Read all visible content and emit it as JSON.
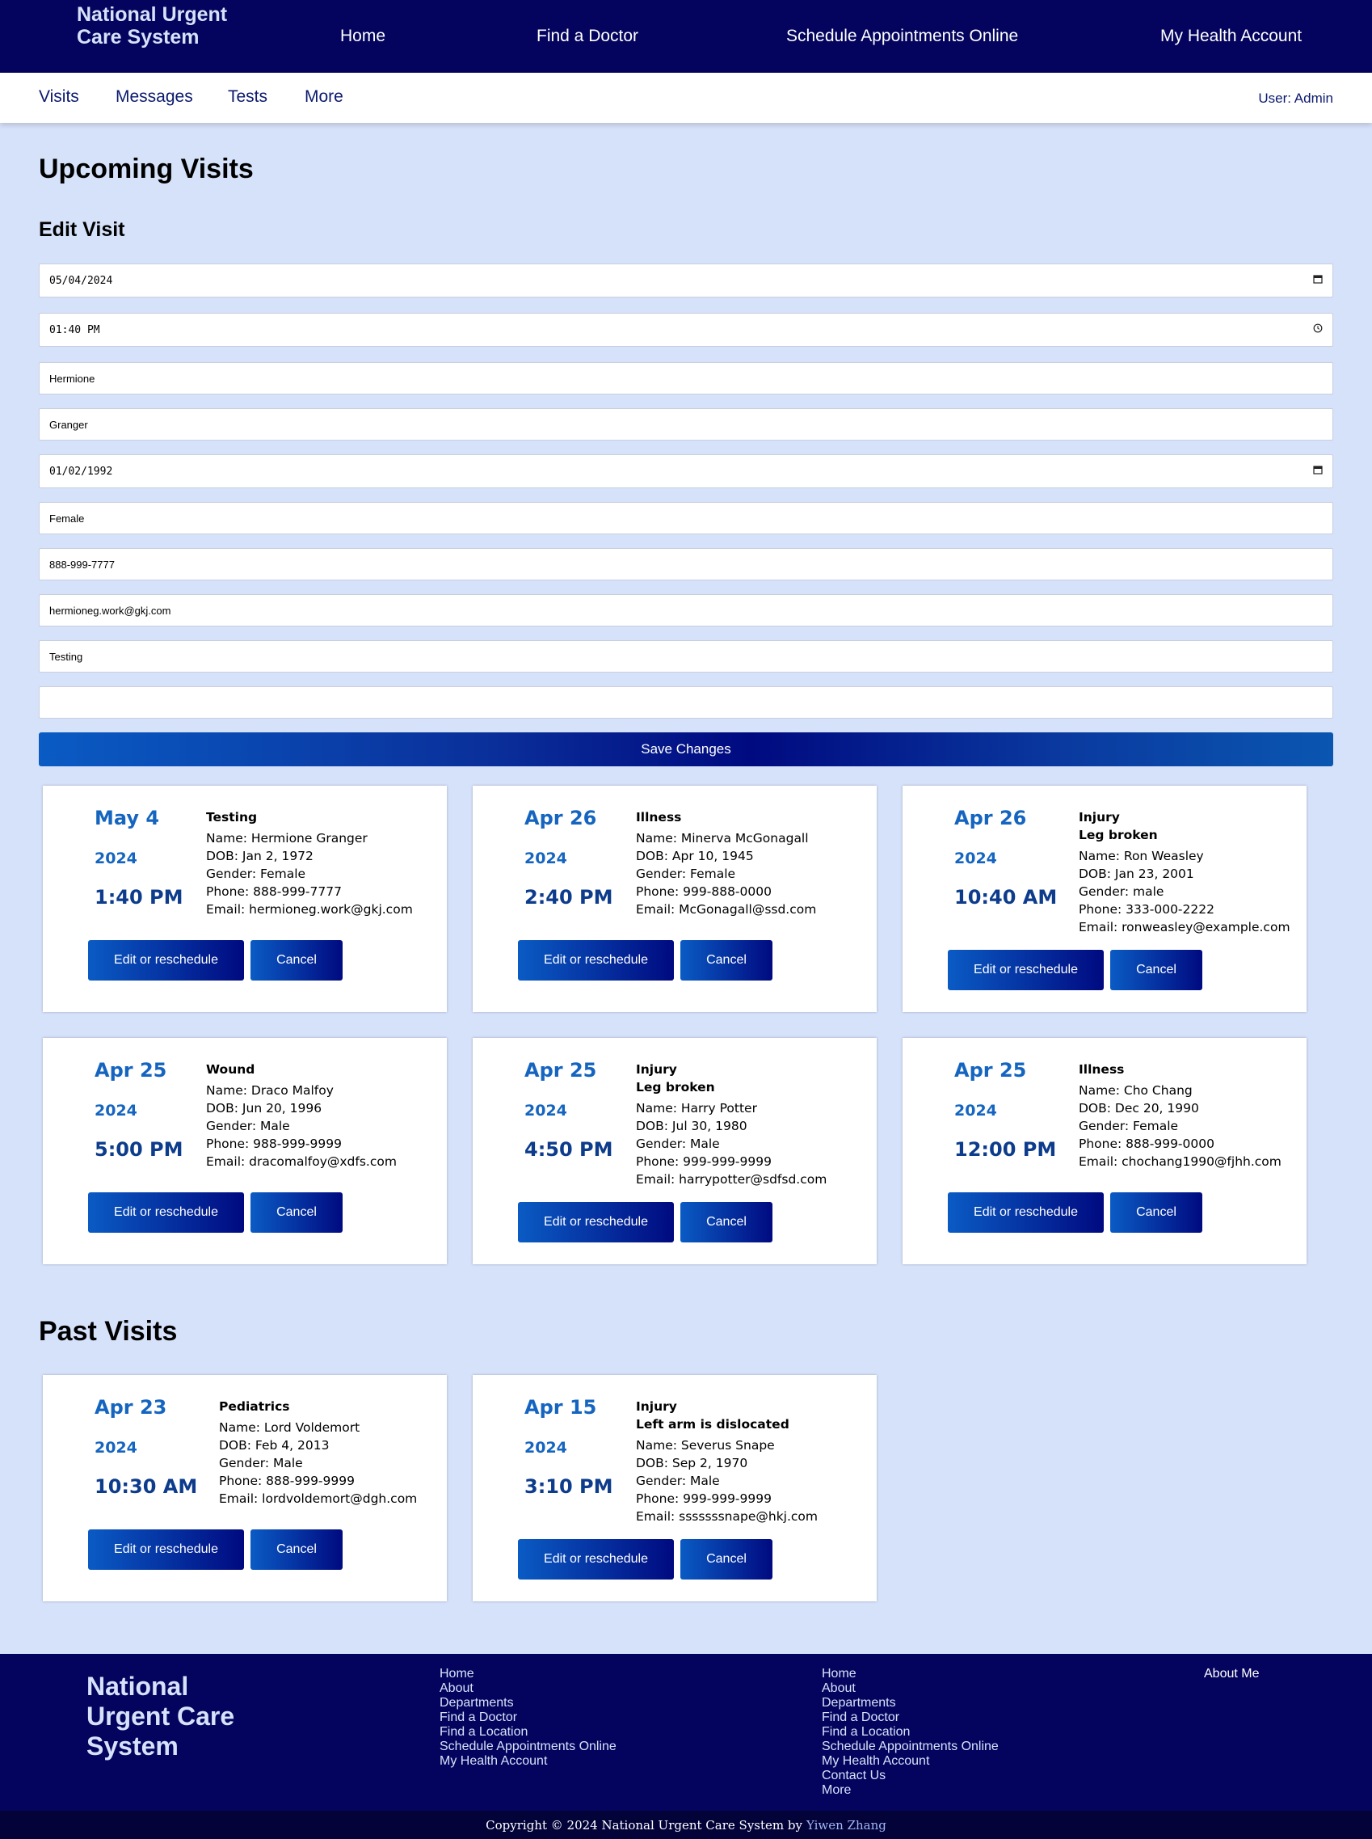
{
  "header": {
    "brand": "National Urgent Care System",
    "nav": [
      "Home",
      "Find a Doctor",
      "Schedule Appointments Online",
      "My Health Account"
    ]
  },
  "subnav": {
    "items": [
      "Visits",
      "Messages",
      "Tests",
      "More"
    ],
    "user": "User: Admin"
  },
  "upcoming_title": "Upcoming Visits",
  "edit_form": {
    "title": "Edit Visit",
    "date": "05/04/2024",
    "time": "01:40 PM",
    "first_name": "Hermione",
    "last_name": "Granger",
    "dob": "01/02/1992",
    "gender": "Female",
    "phone": "888-999-7777",
    "email": "hermioneg.work@gkj.com",
    "reason": "Testing",
    "notes": "",
    "save_label": "Save Changes",
    "calendar_icon": "calendar-icon",
    "clock_icon": "clock-icon"
  },
  "buttons": {
    "edit": "Edit or reschedule",
    "cancel": "Cancel"
  },
  "upcoming_visits": [
    {
      "date": "May 4",
      "year": "2024",
      "time": "1:40 PM",
      "type": "Testing",
      "detail": "",
      "name": "Name: Hermione Granger",
      "dob": "DOB: Jan 2, 1972",
      "gender": "Gender: Female",
      "phone": "Phone: 888-999-7777",
      "email": "Email: hermioneg.work@gkj.com"
    },
    {
      "date": "Apr 26",
      "year": "2024",
      "time": "2:40 PM",
      "type": "Illness",
      "detail": "",
      "name": "Name: Minerva McGonagall",
      "dob": "DOB: Apr 10, 1945",
      "gender": "Gender: Female",
      "phone": "Phone: 999-888-0000",
      "email": "Email: McGonagall@ssd.com"
    },
    {
      "date": "Apr 26",
      "year": "2024",
      "time": "10:40 AM",
      "type": "Injury",
      "detail": "Leg broken",
      "name": "Name: Ron Weasley",
      "dob": "DOB: Jan 23, 2001",
      "gender": "Gender: male",
      "phone": "Phone: 333-000-2222",
      "email": "Email: ronweasley@example.com"
    },
    {
      "date": "Apr 25",
      "year": "2024",
      "time": "5:00 PM",
      "type": "Wound",
      "detail": "",
      "name": "Name: Draco Malfoy",
      "dob": "DOB: Jun 20, 1996",
      "gender": "Gender: Male",
      "phone": "Phone: 988-999-9999",
      "email": "Email: dracomalfoy@xdfs.com"
    },
    {
      "date": "Apr 25",
      "year": "2024",
      "time": "4:50 PM",
      "type": "Injury",
      "detail": "Leg broken",
      "name": "Name: Harry Potter",
      "dob": "DOB: Jul 30, 1980",
      "gender": "Gender: Male",
      "phone": "Phone: 999-999-9999",
      "email": "Email: harrypotter@sdfsd.com"
    },
    {
      "date": "Apr 25",
      "year": "2024",
      "time": "12:00 PM",
      "type": "Illness",
      "detail": "",
      "name": "Name: Cho Chang",
      "dob": "DOB: Dec 20, 1990",
      "gender": "Gender: Female",
      "phone": "Phone: 888-999-0000",
      "email": "Email: chochang1990@fjhh.com"
    }
  ],
  "past_title": "Past Visits",
  "past_visits": [
    {
      "date": "Apr 23",
      "year": "2024",
      "time": "10:30 AM",
      "type": "Pediatrics",
      "detail": "",
      "name": "Name: Lord Voldemort",
      "dob": "DOB: Feb 4, 2013",
      "gender": "Gender: Male",
      "phone": "Phone: 888-999-9999",
      "email": "Email: lordvoldemort@dgh.com"
    },
    {
      "date": "Apr 15",
      "year": "2024",
      "time": "3:10 PM",
      "type": "Injury",
      "detail": "Left arm is dislocated",
      "name": "Name: Severus Snape",
      "dob": "DOB: Sep 2, 1970",
      "gender": "Gender: Male",
      "phone": "Phone: 999-999-9999",
      "email": "Email: sssssssnape@hkj.com"
    }
  ],
  "footer": {
    "brand": "National Urgent Care System",
    "col1": [
      "Home",
      "About",
      "Departments",
      "Find a Doctor",
      "Find a Location",
      "Schedule Appointments Online",
      "My Health Account"
    ],
    "col2": [
      "Home",
      "About",
      "Departments",
      "Find a Doctor",
      "Find a Location",
      "Schedule Appointments Online",
      "My Health Account",
      "Contact Us",
      "More"
    ],
    "about": "About Me",
    "copyright": "Copyright © 2024 National Urgent Care System by",
    "author": "Yiwen Zhang"
  }
}
